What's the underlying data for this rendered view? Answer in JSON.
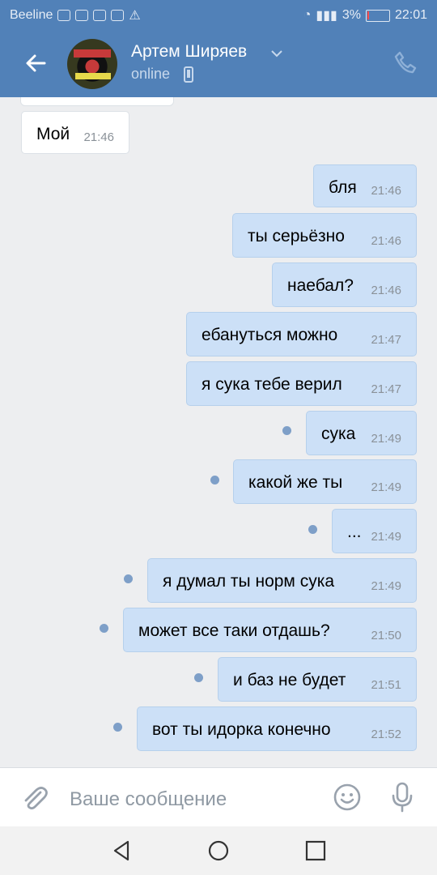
{
  "status_bar": {
    "carrier": "Beeline",
    "battery": "3%",
    "time": "22:01"
  },
  "header": {
    "name": "Артем Ширяев",
    "status": "online"
  },
  "messages": [
    {
      "text": "Мой",
      "time": "21:46",
      "dir": "in"
    },
    {
      "text": "бля",
      "time": "21:46",
      "dir": "out"
    },
    {
      "text": "ты серьёзно",
      "time": "21:46",
      "dir": "out"
    },
    {
      "text": "наебал?",
      "time": "21:46",
      "dir": "out"
    },
    {
      "text": "ебануться можно",
      "time": "21:47",
      "dir": "out"
    },
    {
      "text": "я сука тебе верил",
      "time": "21:47",
      "dir": "out"
    },
    {
      "text": "сука",
      "time": "21:49",
      "dir": "out",
      "unread": true
    },
    {
      "text": "какой же ты",
      "time": "21:49",
      "dir": "out",
      "unread": true
    },
    {
      "text": "...",
      "time": "21:49",
      "dir": "out",
      "unread": true
    },
    {
      "text": "я думал ты норм сука",
      "time": "21:49",
      "dir": "out",
      "unread": true
    },
    {
      "text": "может все таки отдашь?",
      "time": "21:50",
      "dir": "out",
      "unread": true
    },
    {
      "text": "и баз не будет",
      "time": "21:51",
      "dir": "out",
      "unread": true
    },
    {
      "text": "вот ты идорка конечно",
      "time": "21:52",
      "dir": "out",
      "unread": true
    }
  ],
  "composer": {
    "placeholder": "Ваше сообщение"
  },
  "colors": {
    "header": "#5181b8",
    "outgoing": "#cce0f7",
    "background": "#edeef0",
    "unread_dot": "#7e9fc8"
  }
}
